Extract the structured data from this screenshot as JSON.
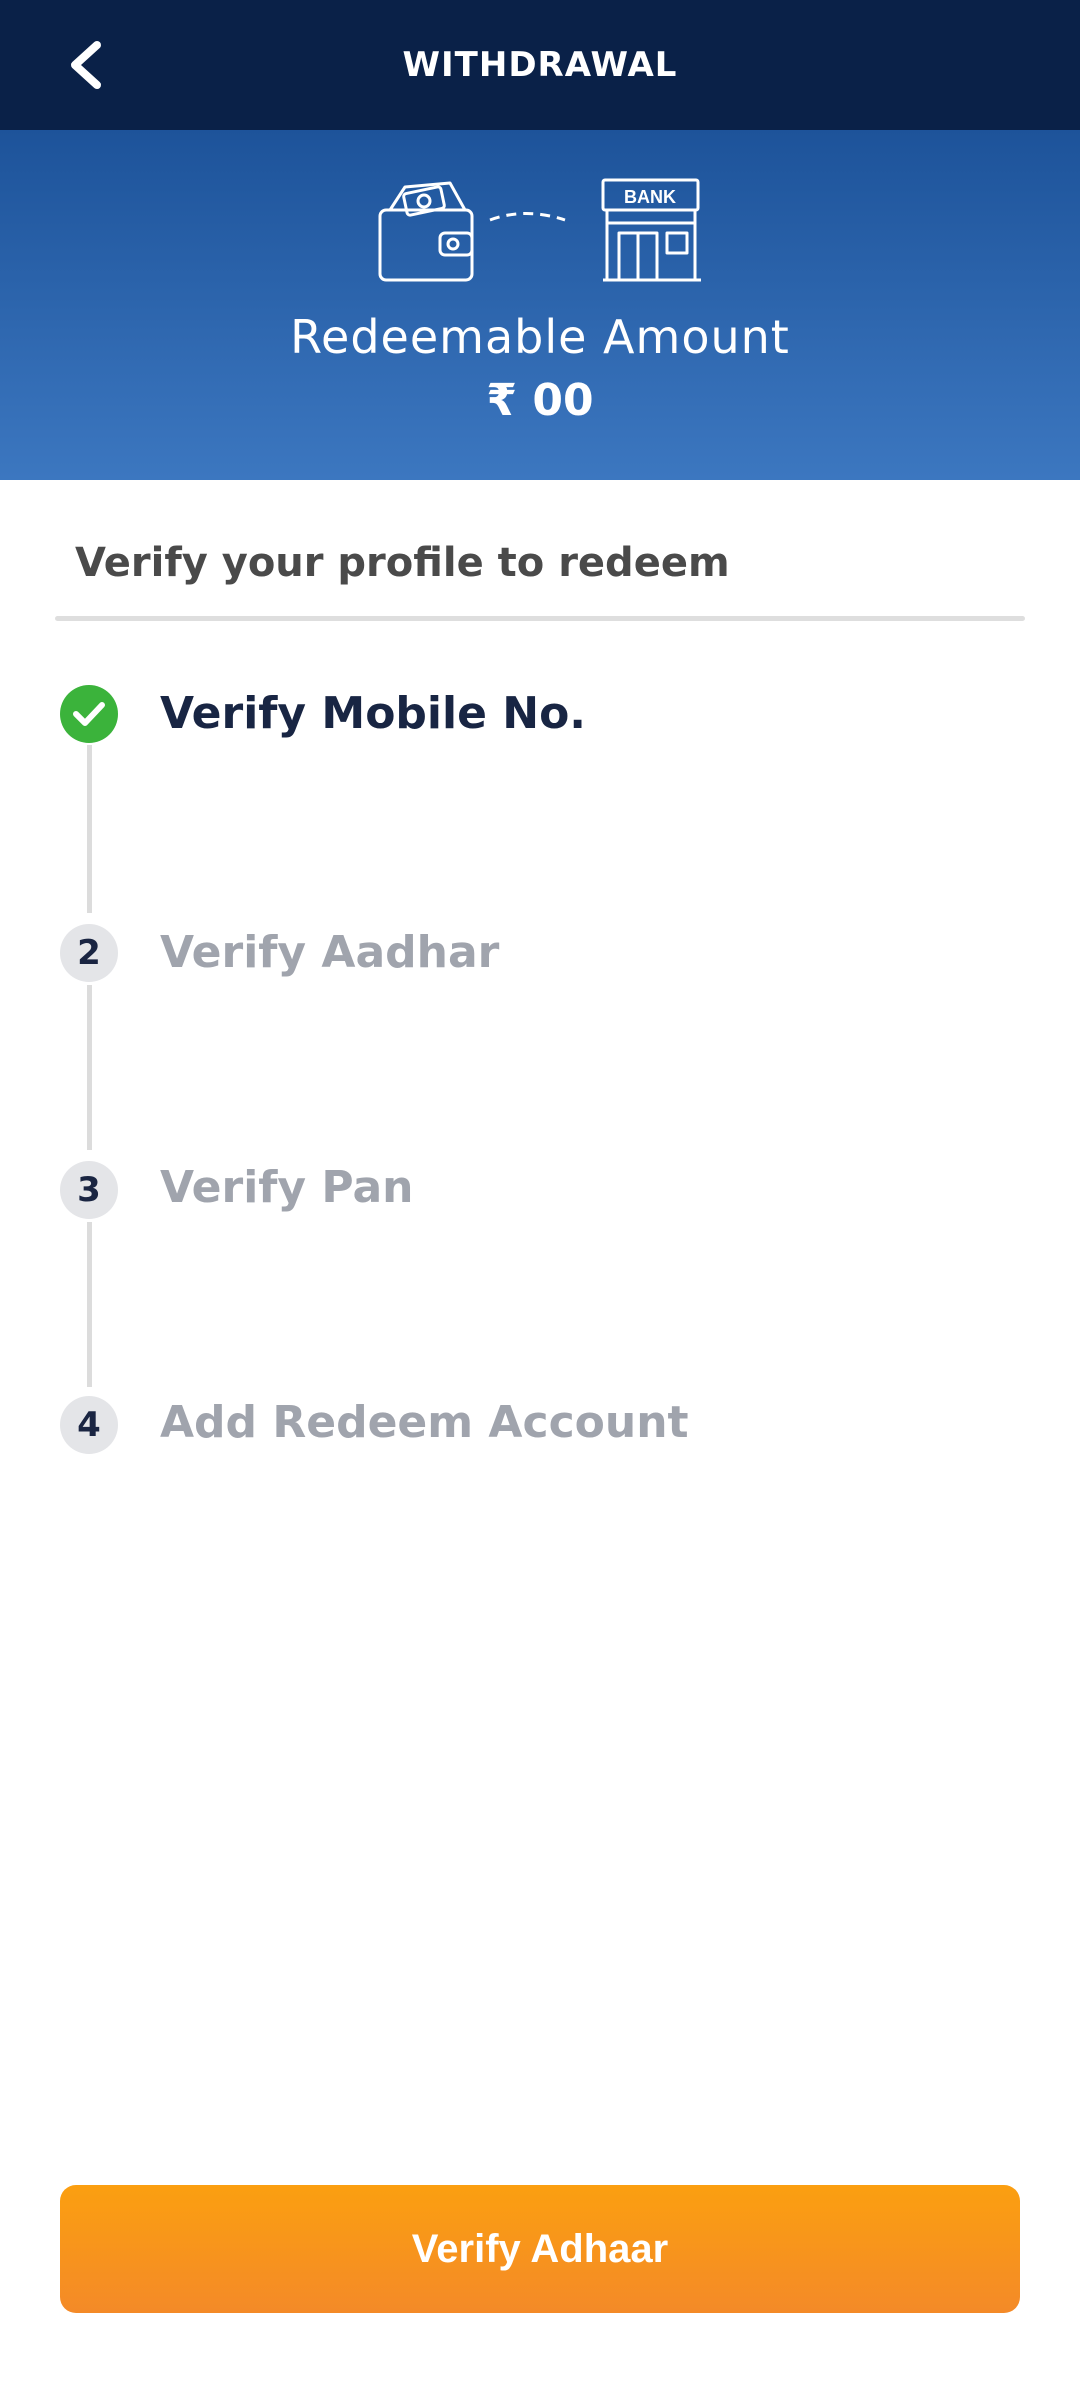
{
  "header": {
    "title": "WITHDRAWAL",
    "back_icon": "chevron-left-icon"
  },
  "hero": {
    "illustration_icons": [
      "wallet-icon",
      "bank-icon"
    ],
    "bank_sign_text": "BANK",
    "label": "Redeemable Amount",
    "amount": "₹ 00"
  },
  "verification": {
    "title": "Verify your profile to redeem",
    "steps": [
      {
        "marker": "check-icon",
        "label": "Verify Mobile No.",
        "status": "completed"
      },
      {
        "marker": "2",
        "label": "Verify Aadhar",
        "status": "pending"
      },
      {
        "marker": "3",
        "label": "Verify Pan",
        "status": "pending"
      },
      {
        "marker": "4",
        "label": "Add Redeem Account",
        "status": "pending"
      }
    ]
  },
  "actions": {
    "primary_label": "Verify Adhaar"
  },
  "colors": {
    "header_bg": "#0a2148",
    "hero_gradient": [
      "#1d539a",
      "#3c77c0"
    ],
    "step_done": "#3bb33b",
    "step_pending": "#a0a4ad",
    "cta_gradient": [
      "#fb9f10",
      "#f48a28"
    ]
  }
}
